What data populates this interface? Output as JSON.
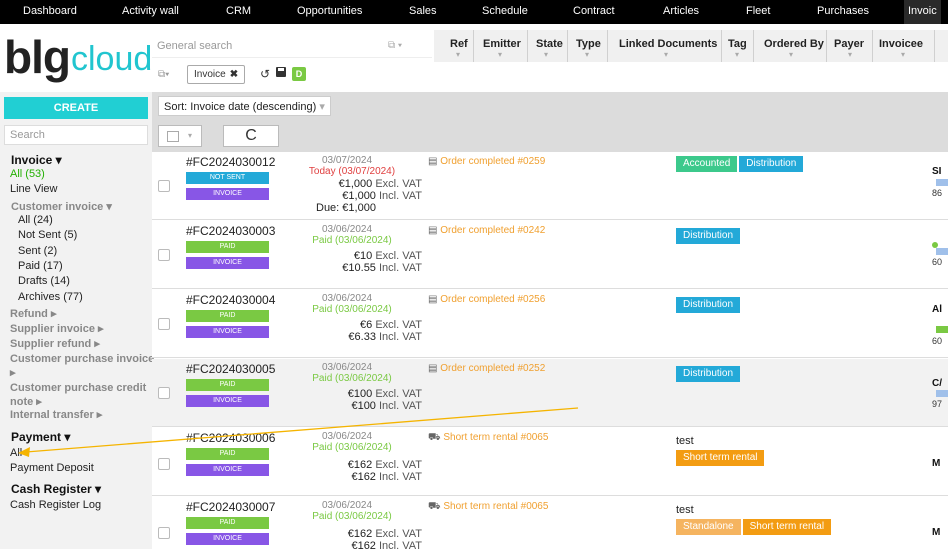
{
  "nav": {
    "items": [
      "Dashboard",
      "Activity wall",
      "CRM",
      "Opportunities",
      "Sales",
      "Schedule",
      "Contract",
      "Articles",
      "Fleet",
      "Purchases",
      "Invoic"
    ]
  },
  "logo": {
    "part1": "blg",
    "part2": "cloud"
  },
  "sidebar": {
    "create_label": "CREATE",
    "search_placeholder": "Search",
    "invoice_header": "Invoice ▾",
    "all": "All (53)",
    "line_view": "Line View",
    "customer_invoice": "Customer invoice ▾",
    "ci_all": "All (24)",
    "not_sent": "Not Sent (5)",
    "sent": "Sent (2)",
    "paid": "Paid (17)",
    "drafts": "Drafts (14)",
    "archives": "Archives (77)",
    "refund": "Refund ▸",
    "supplier_invoice": "Supplier invoice ▸",
    "supplier_refund": "Supplier refund ▸",
    "cpi_line1": "Customer purchase invoice",
    "cpi_line2": "▸",
    "cpcn_line1": "Customer purchase credit",
    "cpcn_line2": "note ▸",
    "internal_transfer": "Internal transfer ▸",
    "payment_header": "Payment ▾",
    "payment_all": "All",
    "payment_deposit": "Payment Deposit",
    "cash_header": "Cash Register ▾",
    "cash_log": "Cash Register Log"
  },
  "toolbar": {
    "general_search_placeholder": "General search",
    "filters": [
      "Ref",
      "Emitter",
      "State",
      "Type",
      "Linked Documents",
      "Tag",
      "Ordered By",
      "Payer",
      "Invoicee"
    ],
    "active_tag": "Invoice",
    "active_tag_close": "✖",
    "d_badge": "D",
    "sort_label": "Sort: Invoice date (descending)",
    "refresh_symbol": "C"
  },
  "rows": [
    {
      "ref": "#FC2024030012",
      "status_badge": "NOT SENT",
      "type_badge": "INVOICE",
      "date": "03/07/2024",
      "status": "Today (03/07/2024)",
      "excl": "€1,000",
      "incl": "€1,000",
      "excl_label": "Excl. VAT",
      "incl_label": "Incl. VAT",
      "due": "Due: €1,000",
      "linked": "Order completed #0259",
      "tags": [
        "Accounted",
        "Distribution"
      ],
      "payer": "SI",
      "payer_sub": "86"
    },
    {
      "ref": "#FC2024030003",
      "status_badge": "PAID",
      "type_badge": "INVOICE",
      "date": "03/06/2024",
      "status": "Paid (03/06/2024)",
      "excl": "€10",
      "incl": "€10.55",
      "excl_label": "Excl. VAT",
      "incl_label": "Incl. VAT",
      "linked": "Order completed #0242",
      "tags": [
        "Distribution"
      ],
      "payer": "",
      "payer_sub": "60"
    },
    {
      "ref": "#FC2024030004",
      "status_badge": "PAID",
      "type_badge": "INVOICE",
      "date": "03/06/2024",
      "status": "Paid (03/06/2024)",
      "excl": "€6",
      "incl": "€6.33",
      "excl_label": "Excl. VAT",
      "incl_label": "Incl. VAT",
      "linked": "Order completed #0256",
      "tags": [
        "Distribution"
      ],
      "payer": "Al",
      "payer_sub": "60"
    },
    {
      "ref": "#FC2024030005",
      "status_badge": "PAID",
      "type_badge": "INVOICE",
      "date": "03/06/2024",
      "status": "Paid (03/06/2024)",
      "excl": "€100",
      "incl": "€100",
      "excl_label": "Excl. VAT",
      "incl_label": "Incl. VAT",
      "linked": "Order completed #0252",
      "tags": [
        "Distribution"
      ],
      "payer": "C/",
      "payer_sub": "97"
    },
    {
      "ref": "#FC2024030006",
      "status_badge": "PAID",
      "type_badge": "INVOICE",
      "date": "03/06/2024",
      "status": "Paid (03/06/2024)",
      "excl": "€162",
      "incl": "€162",
      "excl_label": "Excl. VAT",
      "incl_label": "Incl. VAT",
      "linked": "Short term rental #0065",
      "tag_text": "test",
      "tags": [
        "Short term rental"
      ],
      "payer": "M",
      "payer_sub": ""
    },
    {
      "ref": "#FC2024030007",
      "status_badge": "PAID",
      "type_badge": "INVOICE",
      "date": "03/06/2024",
      "status": "Paid (03/06/2024)",
      "excl": "€162",
      "incl": "€162",
      "excl_label": "Excl. VAT",
      "incl_label": "Incl. VAT",
      "linked": "Short term rental #0065",
      "tag_text": "test",
      "tags": [
        "Standalone",
        "Short term rental"
      ],
      "payer": "M",
      "payer_sub": ""
    }
  ],
  "colors": {
    "accent": "#21cfd3",
    "paid": "#7ac943",
    "not_sent": "#23a9d8",
    "invoice": "#8856e6",
    "linked": "#f0a030",
    "annotation": "#f5b400"
  }
}
